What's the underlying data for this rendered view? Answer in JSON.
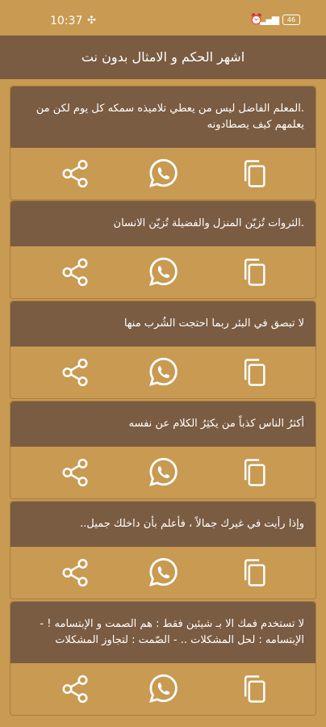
{
  "status_bar": {
    "time": "10:37",
    "battery": "46"
  },
  "app_bar": {
    "title": "اشهر الحكم و الامثال بدون نت"
  },
  "quotes": [
    {
      "text": ".المعلم الفاضل ليس من يعطي تلاميذه سمكه كل يوم لكن من يعلمهم كيف يصطادونه"
    },
    {
      "text": ".الثروات تُزيّن المنزل والفضيلة تُزيّن الانسان"
    },
    {
      "text": "لا تبصق في البئر ربما احتجت الشُرب منها"
    },
    {
      "text": "أكثرُ الناس كذباً من يكثِرُ الكلام عن نفسه"
    },
    {
      "text": "وإذا رأيت في غيرك جمالاً ، فأعلم بأن داخلك جميل.."
    },
    {
      "text": "لا تستخدم فمك الا بـ شيئين فقط : هم الصمت و الإبتسامه ! - الإبتسامه : لحل المشكلات .. - الصّمت : لتجاوز المشكلات"
    }
  ],
  "colors": {
    "background": "#c89a52",
    "card_header": "#7a5c42",
    "text": "#ffffff"
  },
  "icons": {
    "share": "share-icon",
    "whatsapp": "whatsapp-icon",
    "copy": "copy-icon"
  }
}
